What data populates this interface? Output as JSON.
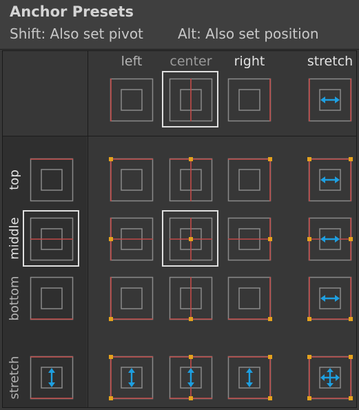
{
  "title": "Anchor Presets",
  "hints": {
    "shift": "Shift: Also set pivot",
    "alt": "Alt: Also set position"
  },
  "columns": [
    {
      "label": "left",
      "state": "normal"
    },
    {
      "label": "center",
      "state": "dimmed"
    },
    {
      "label": "right",
      "state": "active"
    },
    {
      "label": "stretch",
      "state": "active"
    }
  ],
  "rows": [
    {
      "label": "top",
      "state": "active"
    },
    {
      "label": "middle",
      "state": "active"
    },
    {
      "label": "bottom",
      "state": "normal"
    },
    {
      "label": "stretch",
      "state": "normal"
    }
  ],
  "selected": {
    "horizontal": "center",
    "vertical": "middle"
  },
  "colors": {
    "anchor_line": "#c24a48",
    "pivot_dot": "#e5a21d",
    "stretch_arrow": "#1e9fe0",
    "frame": "#8a8a8a",
    "selection_border": "#e0e0e0",
    "label_active": "#e2e2e2",
    "label_dimmed": "#9a9a9a"
  },
  "icons": {
    "stretch_horizontal": "arrow-left-right-icon",
    "stretch_vertical": "arrow-up-down-icon",
    "stretch_both": "arrows-cross-icon",
    "pivot": "pivot-dot-icon"
  }
}
